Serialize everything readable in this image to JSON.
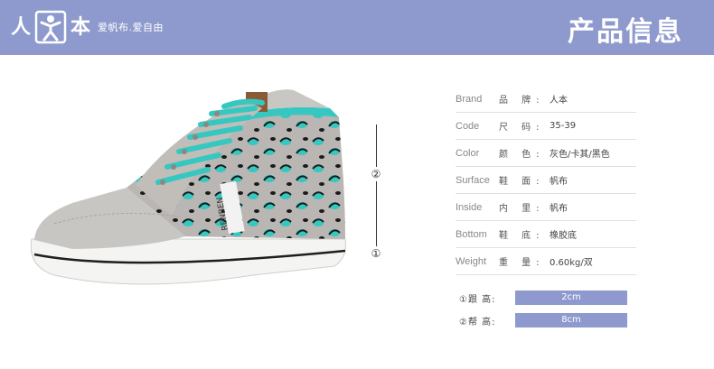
{
  "header": {
    "brand_char_1": "人",
    "brand_char_2": "本",
    "slogan": "爱帆布.爱自由",
    "title": "产品信息"
  },
  "markers": {
    "upper": "②",
    "lower": "①"
  },
  "specs": [
    {
      "en": "Brand",
      "zh": "品 牌:",
      "value": "人本"
    },
    {
      "en": "Code",
      "zh": "尺 码:",
      "value": "35-39"
    },
    {
      "en": "Color",
      "zh": "颜 色:",
      "value": "灰色/卡其/黑色"
    },
    {
      "en": "Surface",
      "zh": "鞋 面:",
      "value": "帆布"
    },
    {
      "en": "Inside",
      "zh": "内 里:",
      "value": "帆布"
    },
    {
      "en": "Bottom",
      "zh": "鞋 底:",
      "value": "橡胶底"
    },
    {
      "en": "Weight",
      "zh": "重 量:",
      "value": "0.60kg/双"
    }
  ],
  "measures": [
    {
      "label": "①跟 高:",
      "value": "2cm"
    },
    {
      "label": "②帮 高:",
      "value": "8cm"
    }
  ],
  "shoe": {
    "tongue_label": "RENBEN"
  },
  "colors": {
    "banner": "#8e9acd",
    "accent_teal": "#36c8c0",
    "canvas_gray": "#bfbcb7"
  }
}
